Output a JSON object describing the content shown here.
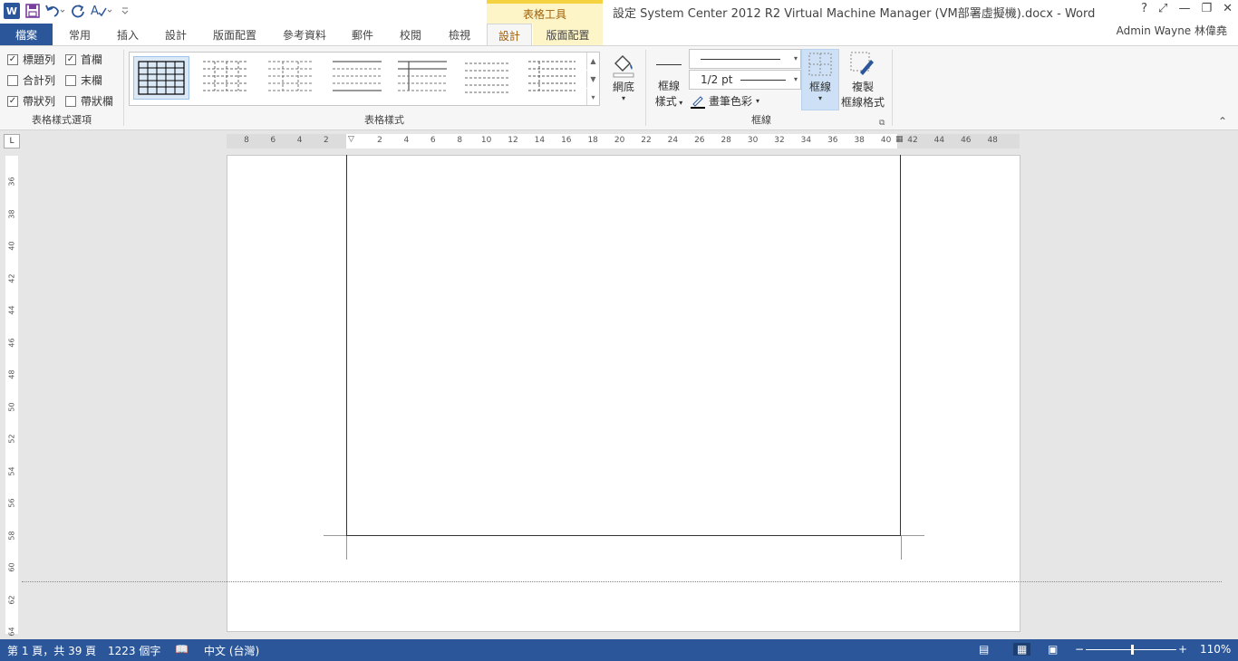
{
  "titlebar": {
    "contextual_header": "表格工具",
    "doc_title": "設定 System Center 2012 R2 Virtual Machine Manager (VM部署虛擬機).docx - Word",
    "word_icon": "W",
    "controls": {
      "help": "?",
      "ribbon_display": "⤢",
      "minimize": "—",
      "restore": "❐",
      "close": "✕"
    }
  },
  "tabs": [
    {
      "label": "檔案"
    },
    {
      "label": "常用"
    },
    {
      "label": "插入"
    },
    {
      "label": "設計"
    },
    {
      "label": "版面配置"
    },
    {
      "label": "參考資料"
    },
    {
      "label": "郵件"
    },
    {
      "label": "校閱"
    },
    {
      "label": "檢視"
    },
    {
      "label": "設計"
    },
    {
      "label": "版面配置"
    }
  ],
  "user": {
    "name": "Admin Wayne 林偉堯"
  },
  "ribbon": {
    "style_options": {
      "label": "表格樣式選項",
      "items": [
        {
          "label": "標題列",
          "checked": true
        },
        {
          "label": "首欄",
          "checked": true
        },
        {
          "label": "合計列",
          "checked": false
        },
        {
          "label": "末欄",
          "checked": false
        },
        {
          "label": "帶狀列",
          "checked": true
        },
        {
          "label": "帶狀欄",
          "checked": false
        }
      ]
    },
    "table_styles": {
      "label": "表格樣式",
      "shading_label": "網底"
    },
    "borders": {
      "label": "框線",
      "border_styles_l1": "框線",
      "border_styles_l2": "樣式",
      "line_weight": "1/2 pt",
      "pen_color": "畫筆色彩",
      "borders_btn": "框線",
      "painter_l1": "複製",
      "painter_l2": "框線格式"
    }
  },
  "ruler": {
    "h_ticks": [
      "8",
      "6",
      "4",
      "2",
      "2",
      "4",
      "6",
      "8",
      "10",
      "12",
      "14",
      "16",
      "18",
      "20",
      "22",
      "24",
      "26",
      "28",
      "30",
      "32",
      "34",
      "36",
      "38",
      "40",
      "42",
      "44",
      "46",
      "48"
    ],
    "v_ticks": [
      "36",
      "38",
      "40",
      "42",
      "44",
      "46",
      "48",
      "50",
      "52",
      "54",
      "56",
      "58",
      "60",
      "62",
      "64"
    ],
    "corner": "L"
  },
  "status": {
    "page": "第 1 頁，共 39 頁",
    "words": "1223 個字",
    "language": "中文 (台灣)",
    "zoom": "110%",
    "zoom_fraction": 0.5
  }
}
